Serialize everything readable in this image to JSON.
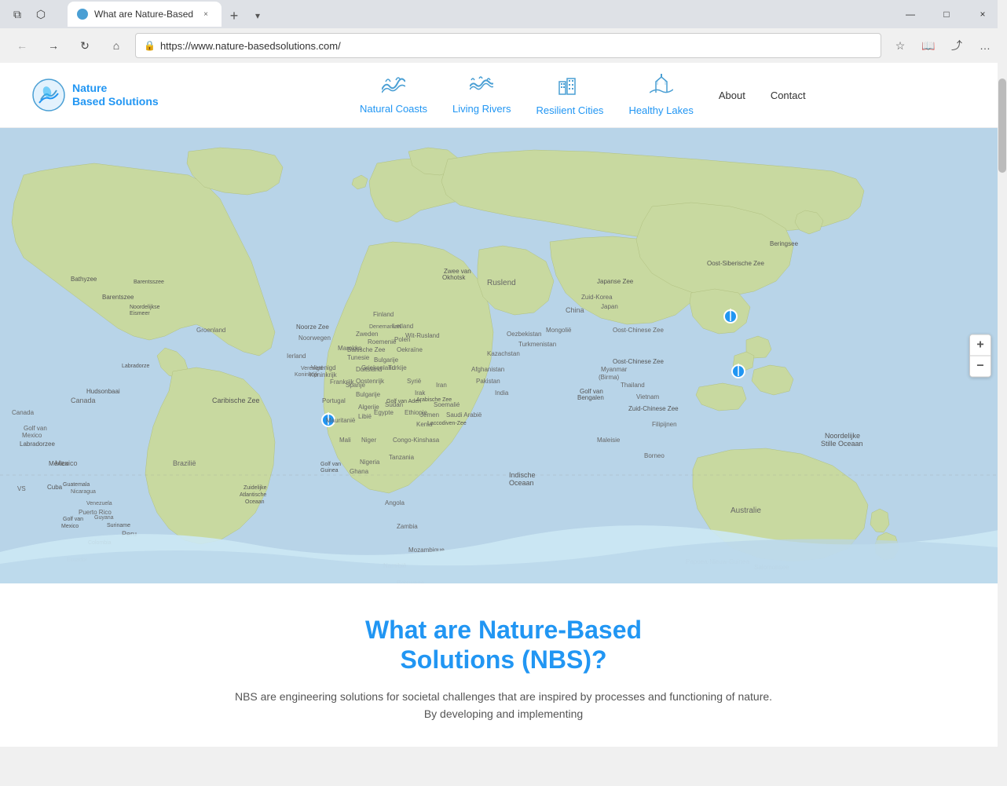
{
  "browser": {
    "tab_title": "What are Nature-Based",
    "tab_close": "×",
    "new_tab": "+",
    "tab_dropdown": "▾",
    "url": "https://www.nature-basedsolutions.com/",
    "window_minimize": "—",
    "window_maximize": "□",
    "window_close": "×",
    "back": "←",
    "forward": "→",
    "refresh": "↻",
    "home": "⌂",
    "favorites": "☆",
    "reader": "📖",
    "share": "⤴",
    "more": "…"
  },
  "site": {
    "logo_line1": "Nature",
    "logo_line2": "Based Solutions",
    "nav": [
      {
        "label": "Natural Coasts",
        "icon": "waves"
      },
      {
        "label": "Living Rivers",
        "icon": "river"
      },
      {
        "label": "Resilient Cities",
        "icon": "city"
      },
      {
        "label": "Healthy Lakes",
        "icon": "lakes"
      },
      {
        "label": "About",
        "icon": ""
      },
      {
        "label": "Contact",
        "icon": ""
      }
    ]
  },
  "map": {
    "zoom_in": "+",
    "zoom_out": "−"
  },
  "content": {
    "title_line1": "What are Nature-Based",
    "title_line2": "Solutions (NBS)?",
    "description": "NBS are engineering solutions for societal challenges that are inspired by processes and functioning of nature. By developing and implementing"
  }
}
